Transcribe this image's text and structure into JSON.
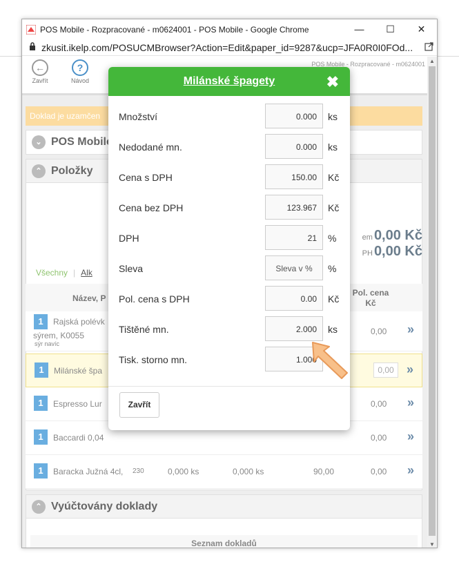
{
  "browser": {
    "window_title": "POS Mobile - Rozpracované - m0624001 - POS Mobile - Google Chrome",
    "url": "zkusit.ikelp.com/POSUCMBrowser?Action=Edit&paper_id=9287&ucp=JFA0R0I0FOd...",
    "minimize": "—",
    "maximize": "☐",
    "close": "✕"
  },
  "toolbar": {
    "close_label": "Zavřít",
    "help_label": "Návod",
    "header_right": "POS Mobile - Rozpracované - m0624001"
  },
  "page": {
    "locked_notice": "Doklad je uzamčen",
    "pos_panel_title": "POS Mobile",
    "items_panel_title": "Položky",
    "sum1_label": "em",
    "sum1_value": "0,00 Kč",
    "sum2_label": "PH",
    "sum2_value": "0,00 Kč",
    "filter_all": "Všechny",
    "filter_sep": "|",
    "filter_alk": "Alk",
    "col_name": "Název, P",
    "col_price": "Pol. cena",
    "col_price_unit": "Kč",
    "items": [
      {
        "qty": "1",
        "name": "Rajská polévk",
        "sub": "sýrem, K0055",
        "note": "sýr navíc",
        "price": "0,00"
      },
      {
        "qty": "1",
        "name": "Milánské špa",
        "price": "0,00"
      },
      {
        "qty": "1",
        "name": "Espresso Lur",
        "price": "0,00"
      },
      {
        "qty": "1",
        "name": "Baccardi 0,04",
        "price": "0,00"
      },
      {
        "qty": "1",
        "name": "Baracka Južná 4cl,",
        "code": "230",
        "q1": "0,000 ks",
        "q2": "0,000 ks",
        "unit_price": "90,00",
        "price": "0,00"
      }
    ],
    "accounted_title": "Vyúčtovány doklady",
    "doc_list": "Seznam dokladů"
  },
  "modal": {
    "title": "Milánské špagety",
    "close_icon": "✖",
    "fields": [
      {
        "label": "Množství",
        "value": "0.000",
        "unit": "ks"
      },
      {
        "label": "Nedodané mn.",
        "value": "0.000",
        "unit": "ks"
      },
      {
        "label": "Cena s DPH",
        "value": "150.00",
        "unit": "Kč"
      },
      {
        "label": "Cena bez DPH",
        "value": "123.967",
        "unit": "Kč"
      },
      {
        "label": "DPH",
        "value": "21",
        "unit": "%"
      },
      {
        "label": "Sleva",
        "value": "Sleva v %",
        "unit": "%"
      },
      {
        "label": "Pol. cena s DPH",
        "value": "0.00",
        "unit": "Kč"
      },
      {
        "label": "Tištěné mn.",
        "value": "2.000",
        "unit": "ks"
      },
      {
        "label": "Tisk. storno mn.",
        "value": "1.000",
        "unit": ""
      }
    ],
    "close_button": "Zavřít"
  }
}
